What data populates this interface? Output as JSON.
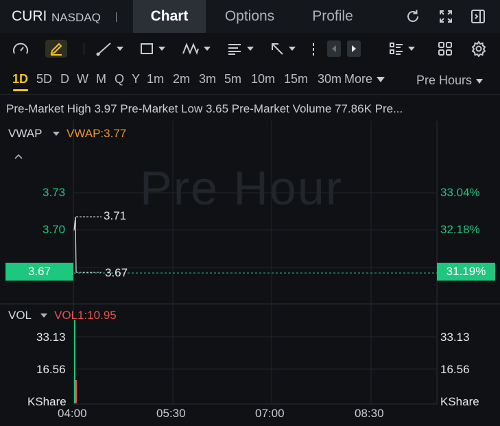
{
  "header": {
    "symbol": "CURI",
    "exchange": "NASDAQ",
    "tabs": [
      {
        "label": "Chart",
        "active": true
      },
      {
        "label": "Options",
        "active": false
      },
      {
        "label": "Profile",
        "active": false
      }
    ],
    "icons": [
      "refresh-icon",
      "expand-icon",
      "collapse-panel-icon"
    ]
  },
  "toolbar": {
    "tools": [
      "gauge-icon",
      "draw-pen-icon",
      "trendline-icon",
      "rectangle-icon",
      "wave-pattern-icon",
      "fib-lines-icon",
      "arrow-icon",
      "ellipsis-vertical-icon",
      "nav-left-icon",
      "nav-right-icon",
      "layout-list-icon",
      "grid-icon",
      "settings-icon"
    ]
  },
  "periods": {
    "items": [
      "1D",
      "5D",
      "D",
      "W",
      "M",
      "Q",
      "Y",
      "1m",
      "2m",
      "3m",
      "5m",
      "10m",
      "15m",
      "30m"
    ],
    "active": "1D",
    "more_label": "More",
    "session_label": "Pre Hours"
  },
  "stats": {
    "text": "Pre-Market High 3.97 Pre-Market Low 3.65 Pre-Market Volume 77.86K Pre..."
  },
  "price_panel": {
    "indicator": "VWAP",
    "indicator_value": "VWAP:3.77",
    "watermark": "Pre Hour",
    "left_axis": [
      "3.73",
      "3.70",
      "3.67"
    ],
    "right_axis": [
      "33.04%",
      "32.18%",
      "31.19%"
    ],
    "last_price": "3.67",
    "last_change": "31.19%",
    "high_marker": "3.71",
    "low_marker": "3.67"
  },
  "volume_panel": {
    "indicator": "VOL",
    "indicator_value": "VOL1:10.95",
    "left_axis": [
      "33.13",
      "16.56",
      "KShare"
    ],
    "right_axis": [
      "33.13",
      "16.56",
      "KShare"
    ]
  },
  "time_axis": [
    "04:00",
    "05:30",
    "07:00",
    "08:30"
  ],
  "colors": {
    "accent": "#f5c518",
    "up": "#1ec77e",
    "vwap_value": "#e8952f",
    "vol_value": "#e8524a"
  }
}
